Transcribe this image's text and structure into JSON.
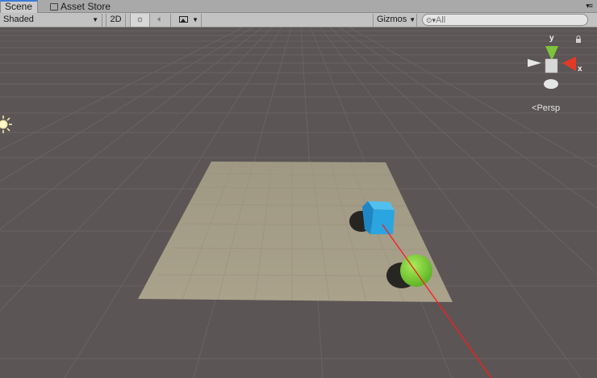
{
  "tabs": [
    {
      "label": "Scene",
      "active": true
    },
    {
      "label": "Asset Store",
      "active": false
    }
  ],
  "toolbar": {
    "draw_mode": "Shaded",
    "mode_2d": "2D",
    "gizmos_label": "Gizmos",
    "search_placeholder": "All"
  },
  "viewport": {
    "axis_y": "y",
    "axis_x": "x",
    "projection": "Persp"
  },
  "colors": {
    "background": "#5b5555",
    "plane": "#a8a08a",
    "cube": "#2aa5e0",
    "sphere": "#86d63a",
    "ray": "#ff1a1a",
    "gizmo_y": "#7dc43a",
    "gizmo_x": "#e33a26"
  },
  "icons": [
    "store-icon",
    "light-icon",
    "audio-icon",
    "image-effects-icon",
    "search-icon",
    "lock-icon",
    "sun-light-icon"
  ]
}
